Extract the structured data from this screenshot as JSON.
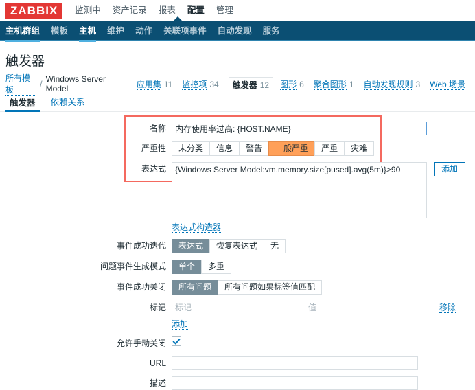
{
  "brand": {
    "logo": "ZABBIX"
  },
  "mainmenu": {
    "items": [
      {
        "label": "监测中",
        "selected": false
      },
      {
        "label": "资产记录",
        "selected": false
      },
      {
        "label": "报表",
        "selected": false
      },
      {
        "label": "配置",
        "selected": true
      },
      {
        "label": "管理",
        "selected": false
      }
    ]
  },
  "subnav": {
    "items": [
      {
        "label": "主机群组",
        "selected": false
      },
      {
        "label": "模板",
        "selected": false
      },
      {
        "label": "主机",
        "selected": true
      },
      {
        "label": "维护",
        "selected": false
      },
      {
        "label": "动作",
        "selected": false
      },
      {
        "label": "关联项事件",
        "selected": false
      },
      {
        "label": "自动发现",
        "selected": false
      },
      {
        "label": "服务",
        "selected": false
      }
    ]
  },
  "page": {
    "title": "触发器"
  },
  "breadcrumb": {
    "root": "所有模板",
    "separator": "/",
    "template": "Windows Server Model",
    "items": [
      {
        "label": "应用集",
        "count": "11",
        "current": false
      },
      {
        "label": "监控项",
        "count": "34",
        "current": false
      },
      {
        "label": "触发器",
        "count": "12",
        "current": true
      },
      {
        "label": "图形",
        "count": "6",
        "current": false
      },
      {
        "label": "聚合图形",
        "count": "1",
        "current": false
      },
      {
        "label": "自动发现规则",
        "count": "3",
        "current": false
      },
      {
        "label": "Web 场景",
        "count": "",
        "current": false
      }
    ]
  },
  "tabs": [
    {
      "label": "触发器",
      "active": true
    },
    {
      "label": "依赖关系",
      "active": false
    }
  ],
  "form": {
    "name": {
      "label": "名称",
      "value": "内存使用率过高: {HOST.NAME}"
    },
    "severity": {
      "label": "严重性",
      "options": [
        "未分类",
        "信息",
        "警告",
        "一般严重",
        "严重",
        "灾难"
      ],
      "selected": "一般严重"
    },
    "expression": {
      "label": "表达式",
      "value": "{Windows Server Model:vm.memory.size[pused].avg(5m)}>90",
      "add_button": "添加",
      "builder_link": "表达式构造器"
    },
    "event_generation": {
      "label": "事件成功迭代",
      "options": [
        "表达式",
        "恢复表达式",
        "无"
      ],
      "selected": "表达式"
    },
    "problem_event_mode": {
      "label": "问题事件生成模式",
      "options": [
        "单个",
        "多重"
      ],
      "selected": "单个"
    },
    "event_close": {
      "label": "事件成功关闭",
      "options": [
        "所有问题",
        "所有问题如果标签值匹配"
      ],
      "selected": "所有问题"
    },
    "tags": {
      "label": "标记",
      "key_placeholder": "标记",
      "value_placeholder": "值",
      "remove_link": "移除",
      "add_link": "添加"
    },
    "manual_close": {
      "label": "允许手动关闭",
      "checked": true
    },
    "url": {
      "label": "URL",
      "value": ""
    },
    "bottom_field": {
      "label": "描述",
      "value": ""
    }
  },
  "colors": {
    "brand_red": "#e33734",
    "nav_dark": "#0b4f73",
    "accent_blue": "#0275b8",
    "severity_orange": "#ffa059",
    "selected_gray": "#768d99",
    "annotation_red": "#f4695f"
  }
}
